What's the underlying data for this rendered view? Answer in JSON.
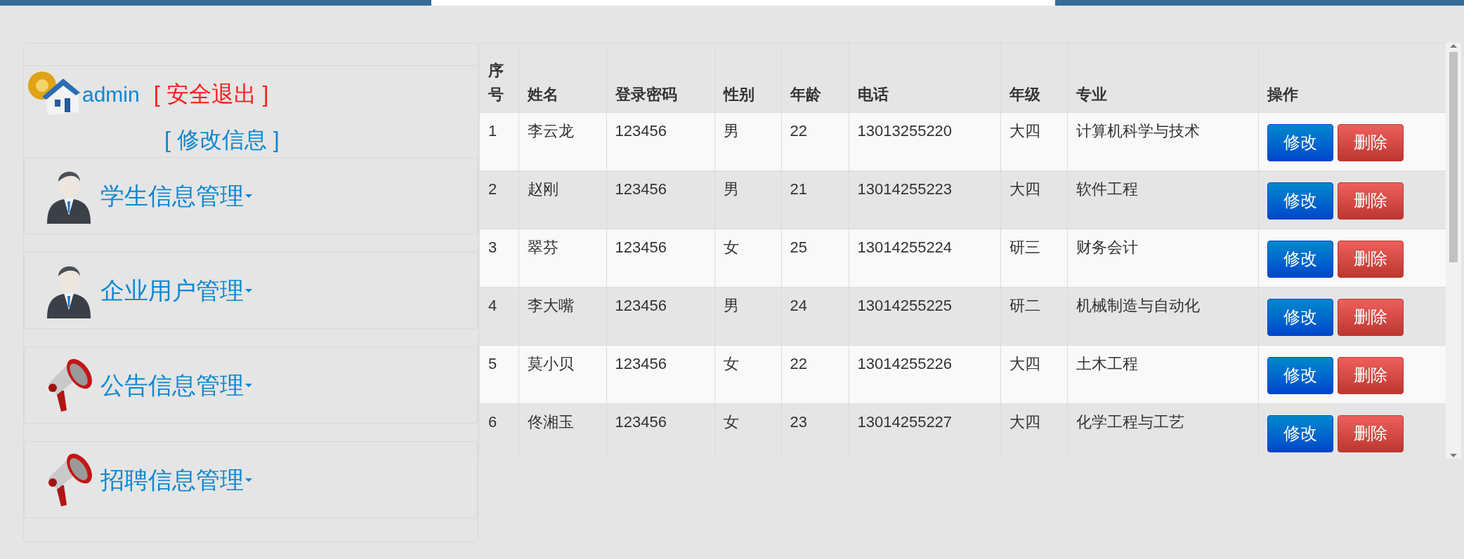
{
  "user": {
    "name": "admin",
    "logout": "[ 安全退出 ]",
    "edit_profile": "[ 修改信息 ]"
  },
  "menu": [
    {
      "label": "学生信息管理",
      "kind": "person"
    },
    {
      "label": "企业用户管理",
      "kind": "person"
    },
    {
      "label": "公告信息管理",
      "kind": "megaphone"
    },
    {
      "label": "招聘信息管理",
      "kind": "megaphone"
    }
  ],
  "table": {
    "columns": [
      "序号",
      "姓名",
      "登录密码",
      "性别",
      "年龄",
      "电话",
      "年级",
      "专业",
      "操作"
    ],
    "rows": [
      {
        "cells": [
          "1",
          "李云龙",
          "123456",
          "男",
          "22",
          "13013255220",
          "大四",
          "计算机科学与技术"
        ],
        "actions": [
          "修改",
          "删除"
        ]
      },
      {
        "cells": [
          "2",
          "赵刚",
          "123456",
          "男",
          "21",
          "13014255223",
          "大四",
          "软件工程"
        ],
        "actions": [
          "修改",
          "删除"
        ]
      },
      {
        "cells": [
          "3",
          "翠芬",
          "123456",
          "女",
          "25",
          "13014255224",
          "研三",
          "财务会计"
        ],
        "actions": [
          "修改",
          "删除"
        ]
      },
      {
        "cells": [
          "4",
          "李大嘴",
          "123456",
          "男",
          "24",
          "13014255225",
          "研二",
          "机械制造与自动化"
        ],
        "actions": [
          "修改",
          "删除"
        ]
      },
      {
        "cells": [
          "5",
          "莫小贝",
          "123456",
          "女",
          "22",
          "13014255226",
          "大四",
          "土木工程"
        ],
        "actions": [
          "修改",
          "删除"
        ]
      },
      {
        "cells": [
          "6",
          "佟湘玉",
          "123456",
          "女",
          "23",
          "13014255227",
          "大四",
          "化学工程与工艺"
        ],
        "actions": [
          "修改",
          "删除"
        ]
      }
    ]
  }
}
